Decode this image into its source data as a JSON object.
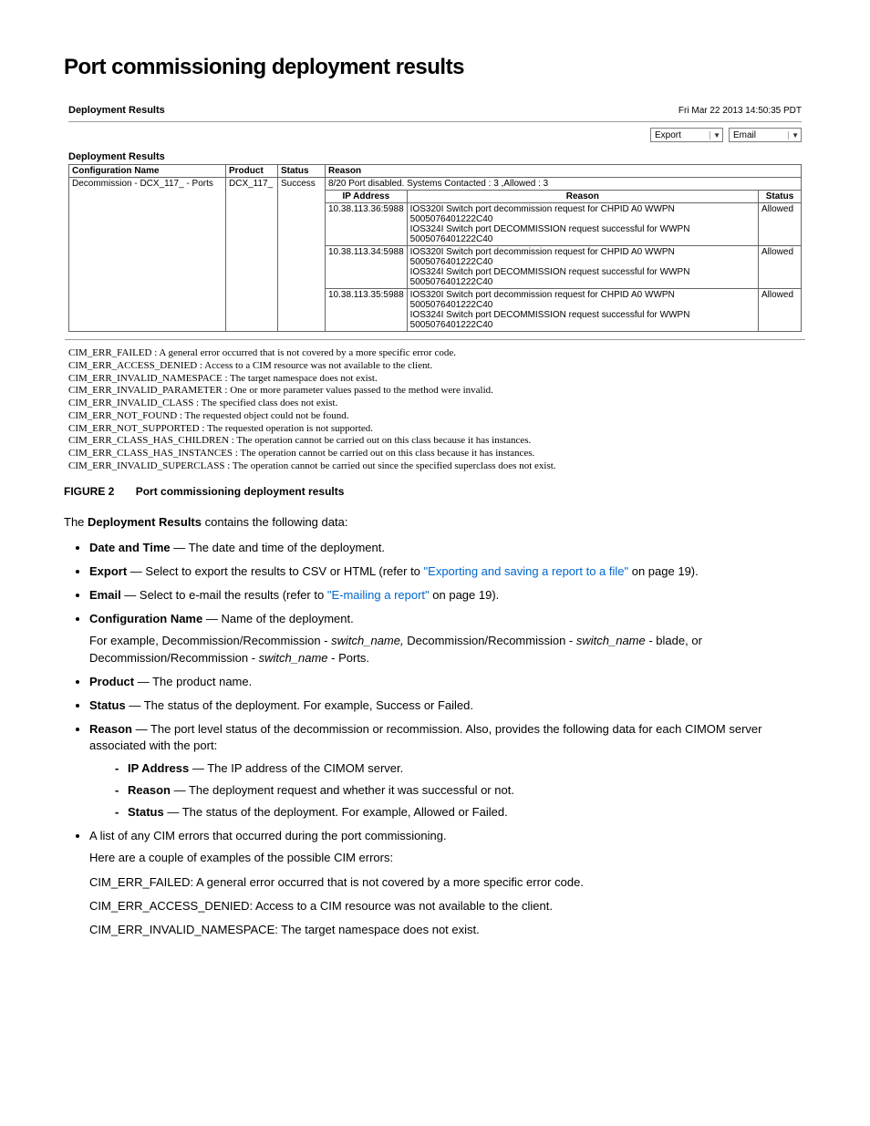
{
  "page": {
    "title": "Port commissioning deployment results"
  },
  "screenshot": {
    "header_title": "Deployment Results",
    "timestamp": "Fri Mar 22 2013 14:50:35 PDT",
    "export_label": "Export",
    "email_label": "Email",
    "subtitle": "Deployment Results",
    "columns": {
      "config_name": "Configuration Name",
      "product": "Product",
      "status": "Status",
      "reason": "Reason"
    },
    "row": {
      "config_name": "Decommission - DCX_117_ - Ports",
      "product": "DCX_117_",
      "status": "Success",
      "reason_summary": "8/20 Port disabled. Systems Contacted : 3 ,Allowed : 3"
    },
    "sub_columns": {
      "ip": "IP Address",
      "reason": "Reason",
      "status": "Status"
    },
    "sub_rows": [
      {
        "ip": "10.38.113.36:5988",
        "reason1": "IOS320I Switch port decommission request for CHPID A0 WWPN 5005076401222C40",
        "reason2": "IOS324I Switch port DECOMMISSION request successful for WWPN 5005076401222C40",
        "status": "Allowed"
      },
      {
        "ip": "10.38.113.34:5988",
        "reason1": "IOS320I Switch port decommission request for CHPID A0 WWPN 5005076401222C40",
        "reason2": "IOS324I Switch port DECOMMISSION request successful for WWPN 5005076401222C40",
        "status": "Allowed"
      },
      {
        "ip": "10.38.113.35:5988",
        "reason1": "IOS320I Switch port decommission request for CHPID A0 WWPN 5005076401222C40",
        "reason2": "IOS324I Switch port DECOMMISSION request successful for WWPN 5005076401222C40",
        "status": "Allowed"
      }
    ],
    "errors": [
      "CIM_ERR_FAILED : A general error occurred that is not covered by a more specific error code.",
      "CIM_ERR_ACCESS_DENIED : Access to a CIM resource was not available to the client.",
      "CIM_ERR_INVALID_NAMESPACE : The target namespace does not exist.",
      "CIM_ERR_INVALID_PARAMETER : One or more parameter values passed to the method were invalid.",
      "CIM_ERR_INVALID_CLASS : The specified class does not exist.",
      "CIM_ERR_NOT_FOUND : The requested object could not be found.",
      "CIM_ERR_NOT_SUPPORTED : The requested operation is not supported.",
      "CIM_ERR_CLASS_HAS_CHILDREN : The operation cannot be carried out on this class because it has instances.",
      "CIM_ERR_CLASS_HAS_INSTANCES : The operation cannot be carried out on this class because it has instances.",
      "CIM_ERR_INVALID_SUPERCLASS : The operation cannot be carried out since the specified superclass does not exist."
    ]
  },
  "figure": {
    "label": "FIGURE 2",
    "text": "Port commissioning deployment results"
  },
  "intro": {
    "prefix": "The ",
    "bold": "Deployment Results",
    "suffix": " contains the following data:"
  },
  "bullets": {
    "date": {
      "label": "Date and Time",
      "desc": " — The date and time of the deployment."
    },
    "export": {
      "label": "Export",
      "desc_pre": " — Select to export the results to CSV or HTML (refer to ",
      "link": "\"Exporting and saving a report to a file\"",
      "desc_post": " on page 19)."
    },
    "email": {
      "label": "Email",
      "desc_pre": " — Select to e-mail the results (refer to ",
      "link": "\"E-mailing a report\"",
      "desc_post": " on page 19)."
    },
    "config": {
      "label": "Configuration Name",
      "desc": " — Name of the deployment.",
      "example_pre": "For example, Decommission/Recommission - ",
      "sw1": "switch_name,",
      "mid1": " Decommission/Recommission - ",
      "sw2": "switch_name",
      "mid2": " - blade, or Decommission/Recommission - ",
      "sw3": "switch_name",
      "mid3": " - Ports."
    },
    "product": {
      "label": "Product",
      "desc": " — The product name."
    },
    "status": {
      "label": "Status",
      "desc": " — The status of the deployment. For example, Success or Failed."
    },
    "reason": {
      "label": "Reason",
      "desc": " — The port level status of the decommission or recommission. Also, provides the following data for each CIMOM server associated with the port:",
      "ip": {
        "label": "IP Address",
        "desc": " — The IP address of the CIMOM server."
      },
      "r2": {
        "label": "Reason",
        "desc": " — The deployment request and whether it was successful or not."
      },
      "st": {
        "label": "Status",
        "desc": " — The status of the deployment. For example, Allowed or Failed."
      }
    },
    "cim_list": {
      "line": "A list of any CIM errors that occurred during the port commissioning.",
      "intro": "Here are a couple of examples of the possible CIM errors:",
      "e1": "CIM_ERR_FAILED: A general error occurred that is not covered by a more specific error code.",
      "e2": "CIM_ERR_ACCESS_DENIED: Access to a CIM resource was not available to the client.",
      "e3": "CIM_ERR_INVALID_NAMESPACE: The target namespace does not exist."
    }
  }
}
